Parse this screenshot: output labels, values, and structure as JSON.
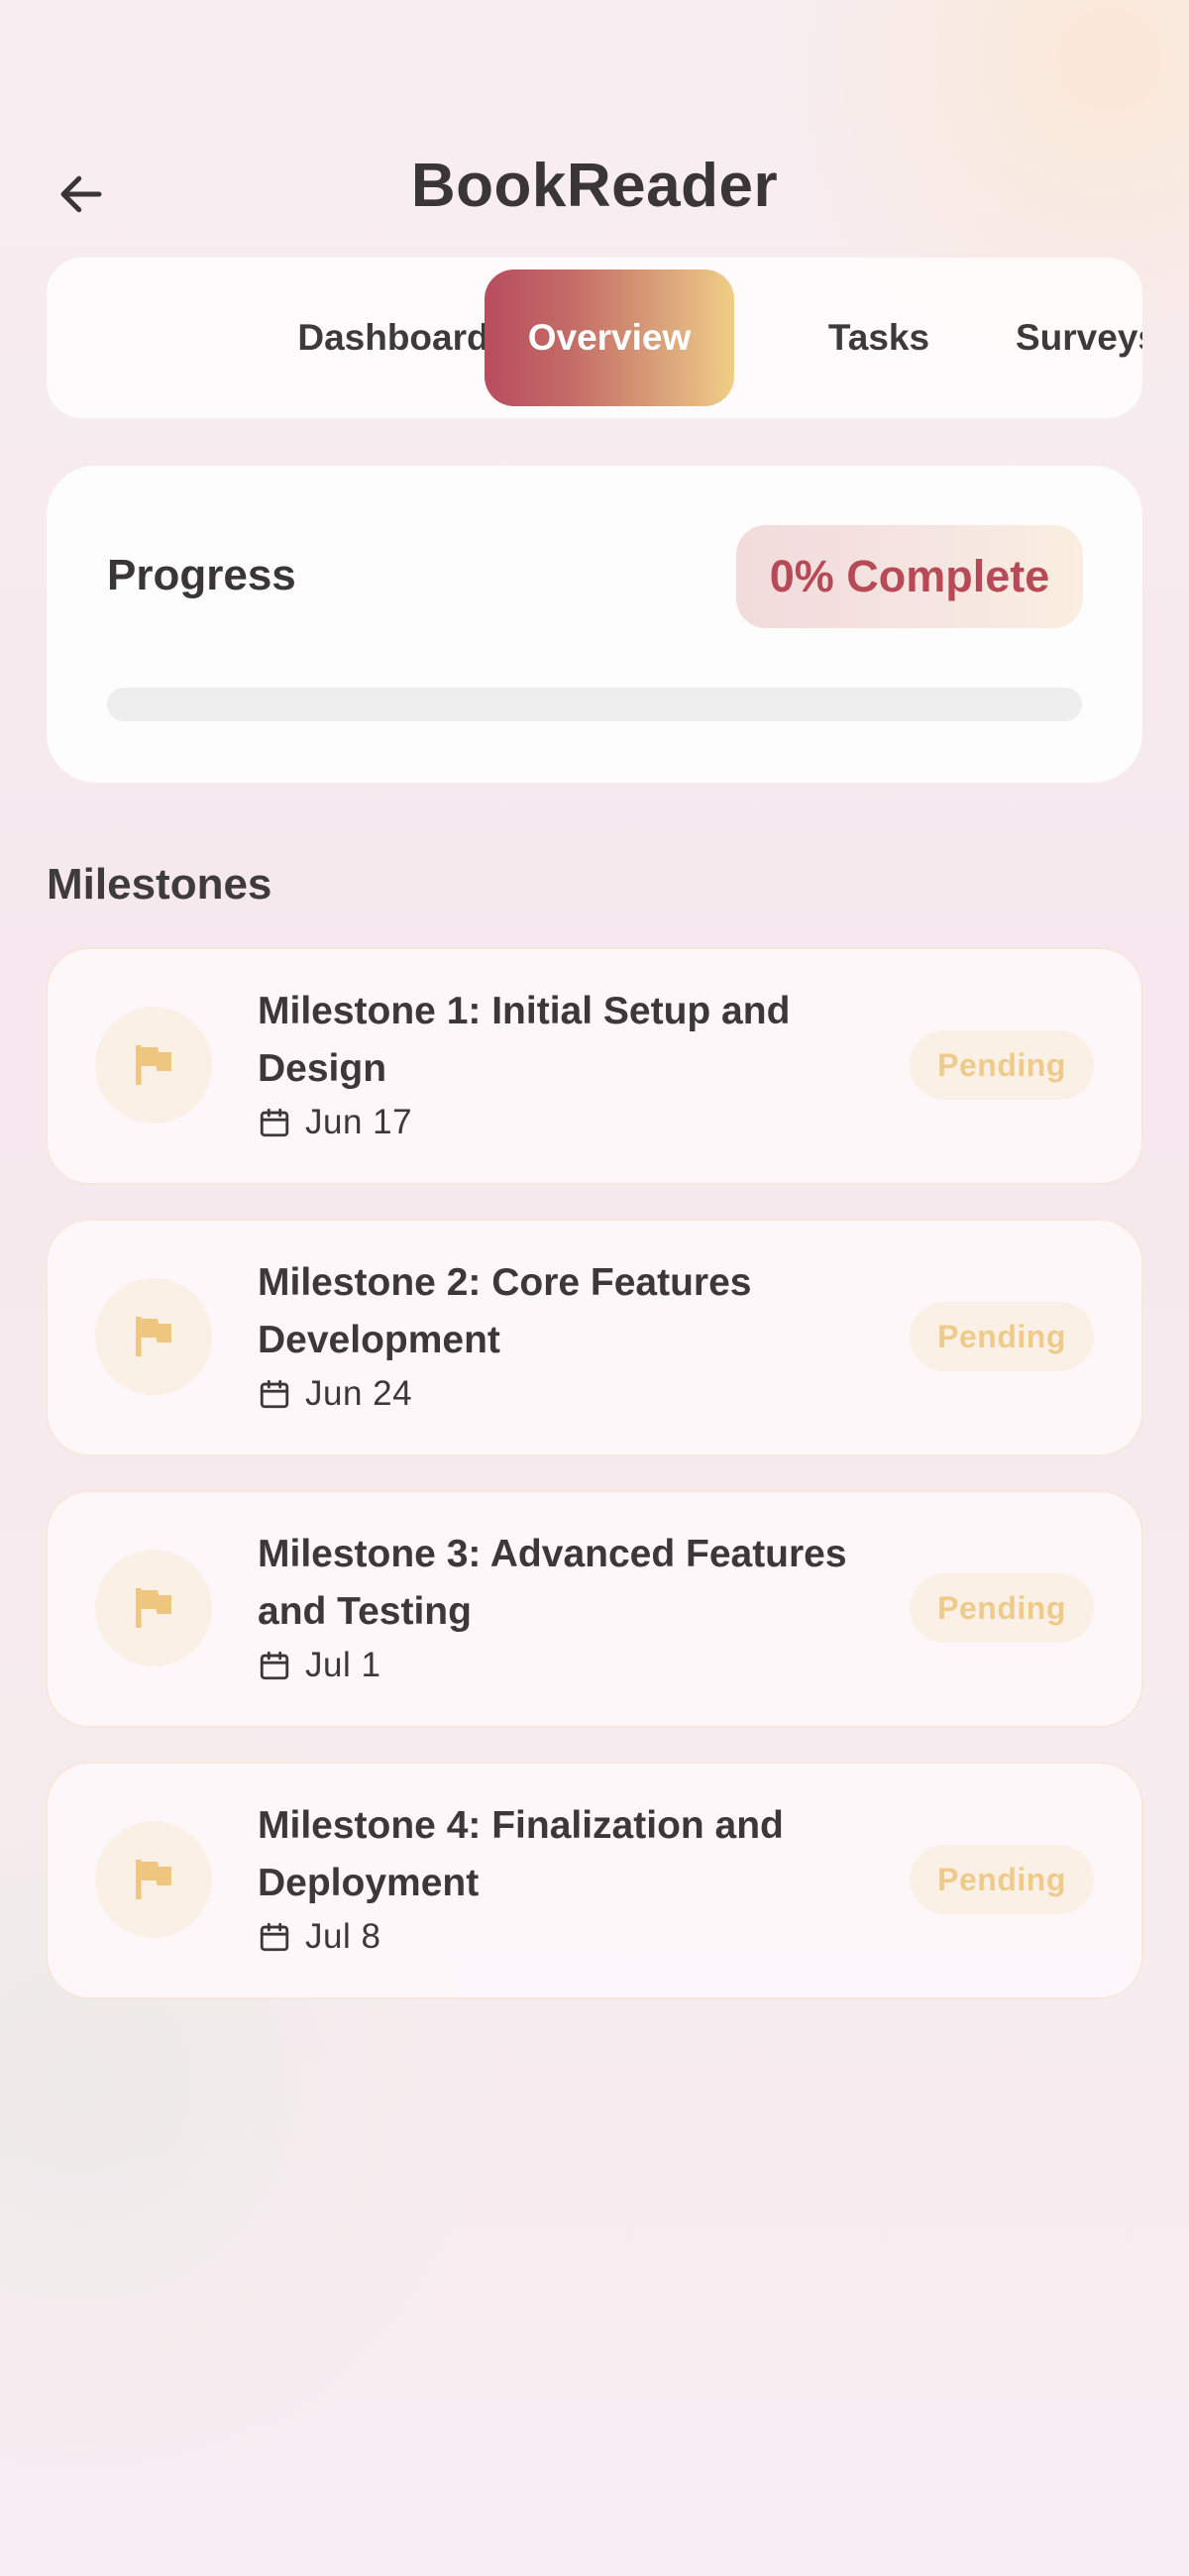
{
  "header": {
    "title": "BookReader",
    "back_icon": "arrow-left-icon"
  },
  "tabs": [
    {
      "label": "Dashboard",
      "active": false
    },
    {
      "label": "Overview",
      "active": true
    },
    {
      "label": "Tasks",
      "active": false
    },
    {
      "label": "Surveys",
      "active": false
    }
  ],
  "progress": {
    "title": "Progress",
    "badge": "0% Complete",
    "value": 0
  },
  "milestones_section": {
    "title": "Milestones",
    "items": [
      {
        "title": "Milestone 1: Initial Setup and Design",
        "date": "Jun 17",
        "status": "Pending",
        "icon": "flag-icon"
      },
      {
        "title": "Milestone 2: Core Features Development",
        "date": "Jun 24",
        "status": "Pending",
        "icon": "flag-icon"
      },
      {
        "title": "Milestone 3: Advanced Features and Testing",
        "date": "Jul 1",
        "status": "Pending",
        "icon": "flag-icon"
      },
      {
        "title": "Milestone 4: Finalization and Deployment",
        "date": "Jul 8",
        "status": "Pending",
        "icon": "flag-icon"
      }
    ]
  },
  "colors": {
    "accent_start": "#b74d5e",
    "accent_end": "#f1ce86",
    "badge_text": "#b84a57",
    "pending_text": "#efcb8b",
    "flag": "#efc680"
  }
}
